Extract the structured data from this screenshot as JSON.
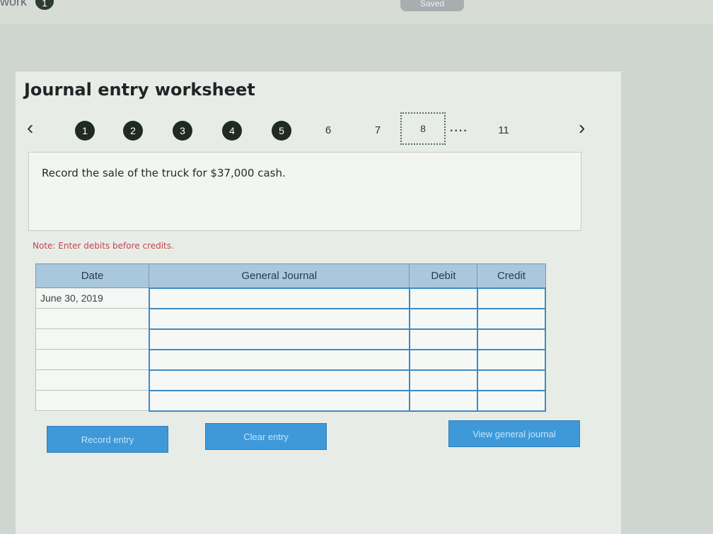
{
  "topbar": {
    "work_label": "work",
    "badge": "1",
    "saved_label": "Saved"
  },
  "worksheet": {
    "title": "Journal entry worksheet",
    "steps": [
      "1",
      "2",
      "3",
      "4",
      "5",
      "6",
      "7",
      "8",
      "11"
    ],
    "current_step": "8",
    "ellipsis": "...."
  },
  "instruction": {
    "text": "Record the sale of the truck for $37,000 cash."
  },
  "note": {
    "text": "Note: Enter debits before credits."
  },
  "table": {
    "headers": [
      "Date",
      "General Journal",
      "Debit",
      "Credit"
    ],
    "date_value": "June 30, 2019",
    "rows": [
      {
        "date": "June 30, 2019",
        "account": "",
        "debit": "",
        "credit": ""
      },
      {
        "date": "",
        "account": "",
        "debit": "",
        "credit": ""
      },
      {
        "date": "",
        "account": "",
        "debit": "",
        "credit": ""
      },
      {
        "date": "",
        "account": "",
        "debit": "",
        "credit": ""
      },
      {
        "date": "",
        "account": "",
        "debit": "",
        "credit": ""
      },
      {
        "date": "",
        "account": "",
        "debit": "",
        "credit": ""
      }
    ]
  },
  "buttons": {
    "record": "Record entry",
    "clear": "Clear entry",
    "view": "View general journal"
  },
  "colors": {
    "header_bg": "#a9c8de",
    "button_bg": "#3f99d8",
    "step_done": "#1e2a22",
    "note_text": "#c0474f"
  },
  "icons": {
    "prev": "chevron-left-icon",
    "next": "chevron-right-icon"
  }
}
